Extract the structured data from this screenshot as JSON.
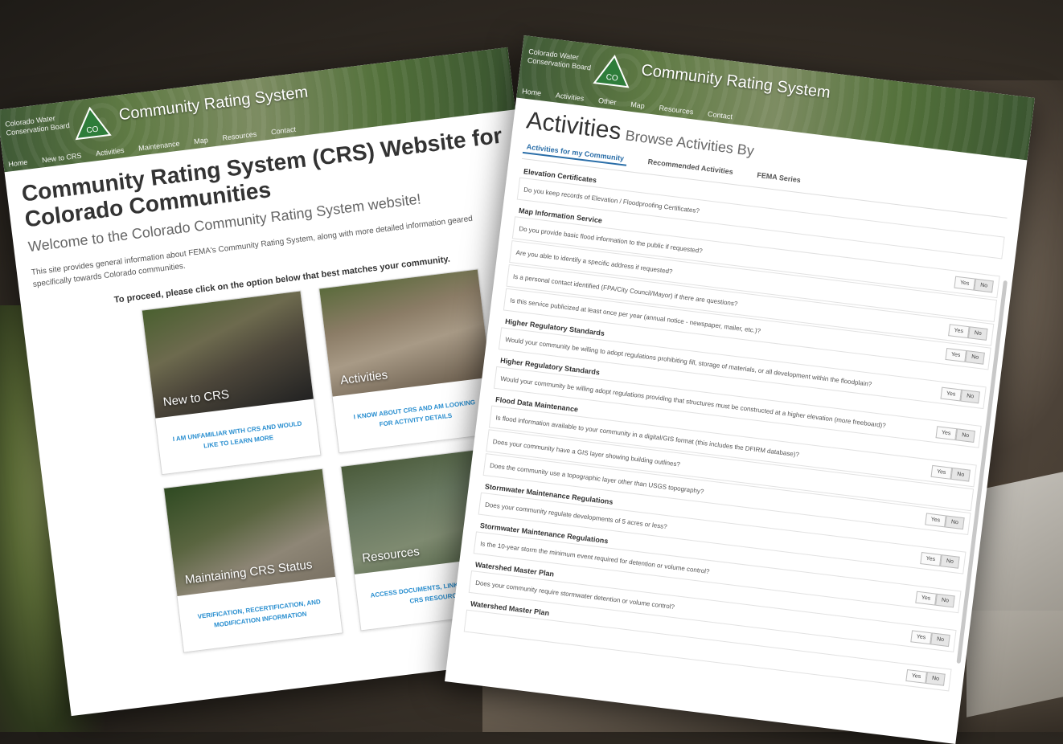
{
  "header": {
    "org_name": "Colorado Water Conservation Board",
    "logo_text": "CO",
    "site_title": "Community Rating System"
  },
  "left_page": {
    "nav": [
      "Home",
      "New to CRS",
      "Activities",
      "Maintenance",
      "Map",
      "Resources",
      "Contact"
    ],
    "title": "Community Rating System (CRS) Website for Colorado Communities",
    "welcome": "Welcome to the Colorado Community Rating System website!",
    "description": "This site provides general information about FEMA's Community Rating System, along with more detailed information geared specifically towards Colorado communities.",
    "prompt": "To proceed, please click on the option below that best matches your community.",
    "tiles": [
      {
        "label": "New to CRS",
        "link": "I AM UNFAMILIAR WITH CRS AND WOULD LIKE TO LEARN MORE"
      },
      {
        "label": "Activities",
        "link": "I KNOW ABOUT CRS AND AM LOOKING FOR ACTIVITY DETAILS"
      },
      {
        "label": "Maintaining CRS Status",
        "link": "VERIFICATION, RECERTIFICATION, AND MODIFICATION INFORMATION"
      },
      {
        "label": "Resources",
        "link": "ACCESS DOCUMENTS, LINKS AND OTHER CRS RESOURCES"
      }
    ]
  },
  "right_page": {
    "nav": [
      "Home",
      "Activities",
      "Other",
      "Map",
      "Resources",
      "Contact"
    ],
    "title": "Activities",
    "subtitle": "Browse Activities By",
    "tabs": [
      "Activities for my Community",
      "Recommended Activities",
      "FEMA Series"
    ],
    "yes_label": "Yes",
    "no_label": "No",
    "sections": [
      {
        "title": "Elevation Certificates",
        "questions": [
          {
            "text": "Do you keep records of Elevation / Floodproofing Certificates?",
            "toggle": false
          }
        ]
      },
      {
        "title": "Map Information Service",
        "questions": [
          {
            "text": "Do you provide basic flood information to the public if requested?",
            "toggle": true
          },
          {
            "text": "Are you able to identify a specific address if requested?",
            "toggle": false
          },
          {
            "text": "Is a personal contact identified (FPA/City Council/Mayor) if there are questions?",
            "toggle": true
          },
          {
            "text": "Is this service publicized at least once per year (annual notice - newspaper, mailer, etc.)?",
            "toggle": true
          }
        ]
      },
      {
        "title": "Higher Regulatory Standards",
        "questions": [
          {
            "text": "Would your community be willing to adopt regulations prohibiting fill, storage of materials, or all development within the floodplain?",
            "toggle": true
          }
        ]
      },
      {
        "title": "Higher Regulatory Standards",
        "questions": [
          {
            "text": "Would your community be willing adopt regulations providing that structures must be constructed at a higher elevation (more freeboard)?",
            "toggle": true
          }
        ]
      },
      {
        "title": "Flood Data Maintenance",
        "questions": [
          {
            "text": "Is flood information available to your community in a digital/GIS format (this includes the DFIRM database)?",
            "toggle": true
          },
          {
            "text": "Does your community have a GIS layer showing building outlines?",
            "toggle": false
          },
          {
            "text": "Does the community use a topographic layer other than USGS topography?",
            "toggle": true
          }
        ]
      },
      {
        "title": "Stormwater Maintenance Regulations",
        "questions": [
          {
            "text": "Does your community regulate developments of 5 acres or less?",
            "toggle": true
          }
        ]
      },
      {
        "title": "Stormwater Maintenance Regulations",
        "questions": [
          {
            "text": "Is the 10-year storm the minimum event required for detention or volume control?",
            "toggle": true
          }
        ]
      },
      {
        "title": "Watershed Master Plan",
        "questions": [
          {
            "text": "Does your community require stormwater detention or volume control?",
            "toggle": true
          }
        ]
      },
      {
        "title": "Watershed Master Plan",
        "questions": [
          {
            "text": "",
            "toggle": true
          }
        ]
      }
    ]
  }
}
